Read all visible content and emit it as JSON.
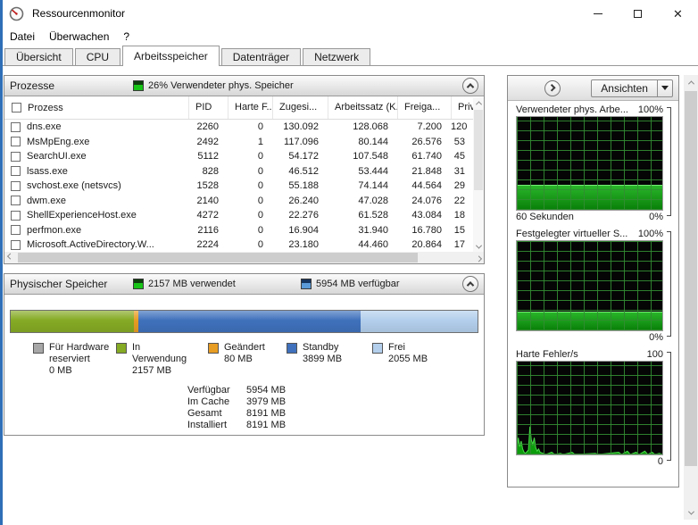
{
  "titlebar": {
    "title": "Ressourcenmonitor"
  },
  "menubar": {
    "items": [
      "Datei",
      "Überwachen",
      "?"
    ]
  },
  "tabs": {
    "items": [
      "Übersicht",
      "CPU",
      "Arbeitsspeicher",
      "Datenträger",
      "Netzwerk"
    ],
    "active": "Arbeitsspeicher"
  },
  "processes": {
    "title": "Prozesse",
    "status": "26% Verwendeter phys. Speicher",
    "columns": [
      "Prozess",
      "PID",
      "Harte F...",
      "Zugesi...",
      "Arbeitssatz (K...",
      "Freiga...",
      "Priv..."
    ],
    "rows": [
      {
        "name": "dns.exe",
        "pid": "2260",
        "hard_faults": "0",
        "commit": "130.092",
        "working_set": "128.068",
        "shareable": "7.200",
        "private": "120"
      },
      {
        "name": "MsMpEng.exe",
        "pid": "2492",
        "hard_faults": "1",
        "commit": "117.096",
        "working_set": "80.144",
        "shareable": "26.576",
        "private": "53"
      },
      {
        "name": "SearchUI.exe",
        "pid": "5112",
        "hard_faults": "0",
        "commit": "54.172",
        "working_set": "107.548",
        "shareable": "61.740",
        "private": "45"
      },
      {
        "name": "lsass.exe",
        "pid": "828",
        "hard_faults": "0",
        "commit": "46.512",
        "working_set": "53.444",
        "shareable": "21.848",
        "private": "31"
      },
      {
        "name": "svchost.exe (netsvcs)",
        "pid": "1528",
        "hard_faults": "0",
        "commit": "55.188",
        "working_set": "74.144",
        "shareable": "44.564",
        "private": "29"
      },
      {
        "name": "dwm.exe",
        "pid": "2140",
        "hard_faults": "0",
        "commit": "26.240",
        "working_set": "47.028",
        "shareable": "24.076",
        "private": "22"
      },
      {
        "name": "ShellExperienceHost.exe",
        "pid": "4272",
        "hard_faults": "0",
        "commit": "22.276",
        "working_set": "61.528",
        "shareable": "43.084",
        "private": "18"
      },
      {
        "name": "perfmon.exe",
        "pid": "2116",
        "hard_faults": "0",
        "commit": "16.904",
        "working_set": "31.940",
        "shareable": "16.780",
        "private": "15"
      },
      {
        "name": "Microsoft.ActiveDirectory.W...",
        "pid": "2224",
        "hard_faults": "0",
        "commit": "23.180",
        "working_set": "44.460",
        "shareable": "20.864",
        "private": "17"
      }
    ]
  },
  "memory": {
    "title": "Physischer Speicher",
    "used_label": "2157 MB verwendet",
    "available_label": "5954 MB verfügbar",
    "segments": [
      {
        "label": "Für Hardware reserviert",
        "value": "0 MB",
        "percent": 0,
        "color": "#a7a7a7"
      },
      {
        "label": "In Verwendung",
        "value": "2157 MB",
        "percent": 26.3,
        "color": "#85aa24"
      },
      {
        "label": "Geändert",
        "value": "80 MB",
        "percent": 1.0,
        "color": "#e79c23"
      },
      {
        "label": "Standby",
        "value": "3899 MB",
        "percent": 47.6,
        "color": "#3f71bc"
      },
      {
        "label": "Frei",
        "value": "2055 MB",
        "percent": 25.1,
        "color": "#b3cfec"
      }
    ],
    "stats": [
      {
        "label": "Verfügbar",
        "value": "5954 MB"
      },
      {
        "label": "Im Cache",
        "value": "3979 MB"
      },
      {
        "label": "Gesamt",
        "value": "8191 MB"
      },
      {
        "label": "Installiert",
        "value": "8191 MB"
      }
    ]
  },
  "right_panel": {
    "views_button": "Ansichten",
    "graph_colors": {
      "fill": "#0c9c0c",
      "line": "#4ada4a",
      "grid": "#328c32",
      "background": "#050505"
    },
    "graphs": [
      {
        "title": "Verwendeter phys. Arbe...",
        "max_label": "100%",
        "min_label": "0%",
        "x_label": "60 Sekunden",
        "type": "area-steady",
        "fill_percent": 27
      },
      {
        "title": "Festgelegter virtueller S...",
        "max_label": "100%",
        "min_label": "0%",
        "x_label": "",
        "type": "area-steady",
        "fill_percent": 21
      },
      {
        "title": "Harte Fehler/s",
        "max_label": "100",
        "min_label": "0",
        "x_label": "",
        "type": "spikes",
        "points": [
          [
            0,
            3
          ],
          [
            1,
            15
          ],
          [
            2,
            7
          ],
          [
            3,
            12
          ],
          [
            4,
            5
          ],
          [
            5,
            2
          ],
          [
            6,
            1
          ],
          [
            8,
            4
          ],
          [
            9,
            25
          ],
          [
            10,
            13
          ],
          [
            11,
            9
          ],
          [
            12,
            15
          ],
          [
            13,
            6
          ],
          [
            14,
            3
          ],
          [
            15,
            5
          ],
          [
            16,
            2
          ],
          [
            18,
            1
          ],
          [
            20,
            0
          ],
          [
            24,
            2
          ],
          [
            26,
            0
          ],
          [
            30,
            1
          ],
          [
            32,
            0
          ],
          [
            38,
            2
          ],
          [
            40,
            0
          ],
          [
            54,
            1
          ],
          [
            56,
            0
          ],
          [
            70,
            2
          ],
          [
            72,
            0
          ],
          [
            76,
            3
          ],
          [
            78,
            0
          ],
          [
            82,
            2
          ],
          [
            84,
            0
          ],
          [
            88,
            3
          ],
          [
            90,
            0
          ],
          [
            93,
            2
          ],
          [
            95,
            0
          ],
          [
            98,
            1
          ],
          [
            100,
            0
          ]
        ]
      }
    ]
  }
}
